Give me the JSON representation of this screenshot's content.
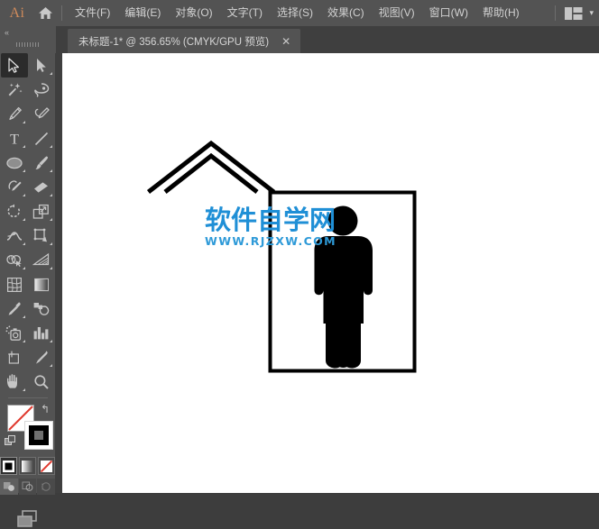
{
  "app": {
    "name": "Ai",
    "logo_color": "#d08b5b",
    "home_icon": "home-icon"
  },
  "menubar": {
    "items": [
      {
        "label": "文件(F)"
      },
      {
        "label": "编辑(E)"
      },
      {
        "label": "对象(O)"
      },
      {
        "label": "文字(T)"
      },
      {
        "label": "选择(S)"
      },
      {
        "label": "效果(C)"
      },
      {
        "label": "视图(V)"
      },
      {
        "label": "窗口(W)"
      },
      {
        "label": "帮助(H)"
      }
    ],
    "workspace_icon": "workspace-layout-icon",
    "workspace_chevron": "▾"
  },
  "tabbar": {
    "tab_title": "未标题-1* @ 356.65% (CMYK/GPU 预览)",
    "close_glyph": "✕"
  },
  "toolbar": {
    "collapse_glyph": "«",
    "tools": [
      {
        "name": "selection-tool",
        "label": "选择工具",
        "active": true,
        "has_flyout": false
      },
      {
        "name": "direct-selection-tool",
        "label": "直接选择工具",
        "active": false,
        "has_flyout": true
      },
      {
        "name": "magic-wand-tool",
        "label": "魔棒工具",
        "active": false,
        "has_flyout": false
      },
      {
        "name": "lasso-tool",
        "label": "套索工具",
        "active": false,
        "has_flyout": false
      },
      {
        "name": "pen-tool",
        "label": "钢笔工具",
        "active": false,
        "has_flyout": true
      },
      {
        "name": "curvature-tool",
        "label": "曲率工具",
        "active": false,
        "has_flyout": false
      },
      {
        "name": "type-tool",
        "label": "文字工具",
        "active": false,
        "has_flyout": true
      },
      {
        "name": "line-segment-tool",
        "label": "直线段工具",
        "active": false,
        "has_flyout": true
      },
      {
        "name": "ellipse-tool",
        "label": "椭圆工具",
        "active": false,
        "has_flyout": true
      },
      {
        "name": "paintbrush-tool",
        "label": "画笔工具",
        "active": false,
        "has_flyout": true
      },
      {
        "name": "shaper-tool",
        "label": "Shaper 工具",
        "active": false,
        "has_flyout": true
      },
      {
        "name": "eraser-tool",
        "label": "橡皮擦工具",
        "active": false,
        "has_flyout": true
      },
      {
        "name": "rotate-tool",
        "label": "旋转工具",
        "active": false,
        "has_flyout": true
      },
      {
        "name": "scale-tool",
        "label": "比例缩放工具",
        "active": false,
        "has_flyout": true
      },
      {
        "name": "width-tool",
        "label": "宽度工具",
        "active": false,
        "has_flyout": true
      },
      {
        "name": "free-transform-tool",
        "label": "自由变换工具",
        "active": false,
        "has_flyout": true
      },
      {
        "name": "shape-builder-tool",
        "label": "形状生成器工具",
        "active": false,
        "has_flyout": true
      },
      {
        "name": "perspective-grid-tool",
        "label": "透视网格工具",
        "active": false,
        "has_flyout": true
      },
      {
        "name": "mesh-tool",
        "label": "网格工具",
        "active": false,
        "has_flyout": false
      },
      {
        "name": "gradient-tool",
        "label": "渐变工具",
        "active": false,
        "has_flyout": false
      },
      {
        "name": "eyedropper-tool",
        "label": "吸管工具",
        "active": false,
        "has_flyout": true
      },
      {
        "name": "blend-tool",
        "label": "混合工具",
        "active": false,
        "has_flyout": false
      },
      {
        "name": "symbol-sprayer-tool",
        "label": "符号喷枪工具",
        "active": false,
        "has_flyout": true
      },
      {
        "name": "column-graph-tool",
        "label": "柱形图工具",
        "active": false,
        "has_flyout": true
      },
      {
        "name": "artboard-tool",
        "label": "画板工具",
        "active": false,
        "has_flyout": false
      },
      {
        "name": "slice-tool",
        "label": "切片工具",
        "active": false,
        "has_flyout": true
      },
      {
        "name": "hand-tool",
        "label": "抓手工具",
        "active": false,
        "has_flyout": true
      },
      {
        "name": "zoom-tool",
        "label": "缩放工具",
        "active": false,
        "has_flyout": false
      }
    ],
    "color": {
      "stroke_swatch": "none",
      "stroke_color": "#ffffff",
      "fill_color": "#000000",
      "swap_glyph": "↰",
      "default_label": "默认填色和描边"
    },
    "modes": [
      {
        "name": "color-mode-button",
        "label": "颜色",
        "selected": true
      },
      {
        "name": "gradient-mode-button",
        "label": "渐变",
        "selected": false
      },
      {
        "name": "none-mode-button",
        "label": "无",
        "selected": false
      }
    ],
    "draw_modes": [
      {
        "name": "draw-normal-button",
        "label": "正常绘图",
        "selected": true
      },
      {
        "name": "draw-behind-button",
        "label": "背面绘图",
        "selected": false
      },
      {
        "name": "draw-inside-button",
        "label": "内部绘图",
        "selected": false
      }
    ],
    "screen_mode": {
      "name": "change-screen-mode-button",
      "label": "更改屏幕模式"
    }
  },
  "canvas": {
    "background": "#ffffff",
    "artwork": {
      "name": "hanging-picture-frame-with-person",
      "stroke_color": "#000000",
      "fill_color": "#000000",
      "description": "画框悬挂图形与人物剪影"
    },
    "watermark": {
      "cn": "软件自学网",
      "en": "WWW.RJZXW.COM",
      "color": "#1f8fd6"
    }
  }
}
